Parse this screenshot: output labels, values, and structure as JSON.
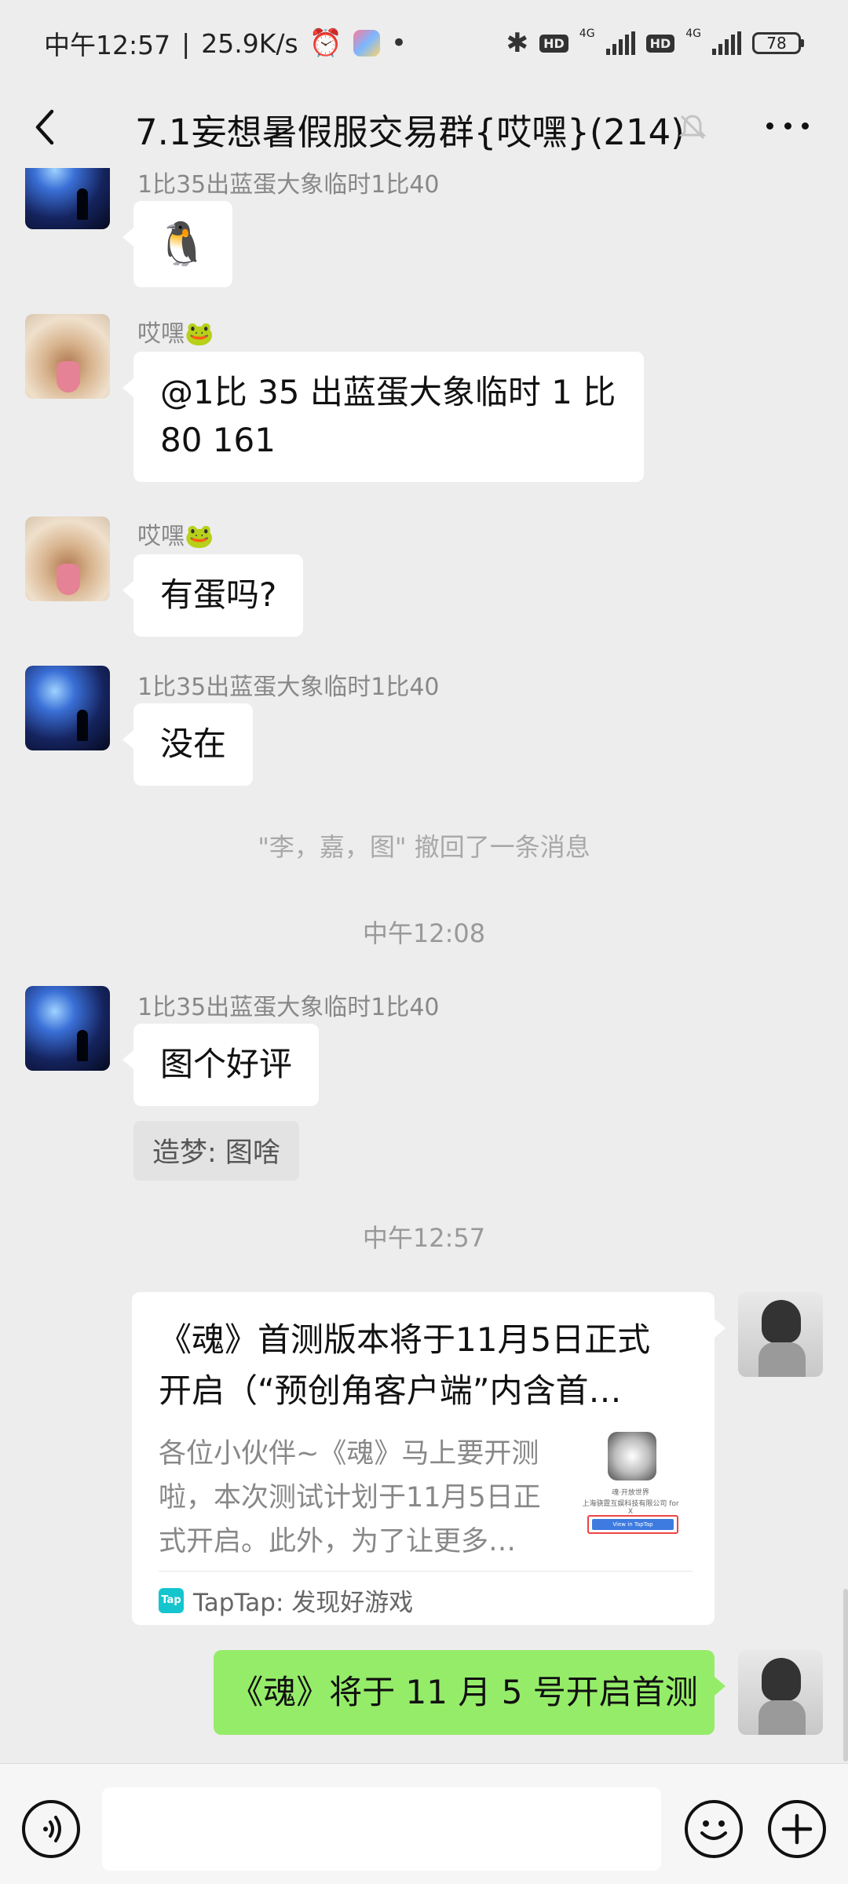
{
  "status_bar": {
    "time": "中午12:57",
    "speed": "25.9K/s",
    "dot": "•",
    "hd1": "HD",
    "net1": "4G",
    "hd2": "HD",
    "net2": "4G",
    "battery": "78"
  },
  "header": {
    "title": "7.1妄想暑假服交易群{哎嘿}(214)"
  },
  "messages": {
    "m0_sender": "1比35出蓝蛋大象临时1比40",
    "m0_text": "🐧",
    "m1_sender": "哎嘿🐸",
    "m1_text_line1": "@1比 35 出蓝蛋大象临时 1 比",
    "m1_text_line2": "80 161",
    "m2_sender": "哎嘿🐸",
    "m2_text": "有蛋吗?",
    "m3_sender": "1比35出蓝蛋大象临时1比40",
    "m3_text": "没在",
    "recall_notice": "\"李，嘉，图\" 撤回了一条消息",
    "time1": "中午12:08",
    "m4_sender": "1比35出蓝蛋大象临时1比40",
    "m4_text": "图个好评",
    "m4_quote": "造梦: 图啥",
    "time2": "中午12:57",
    "card": {
      "title": "《魂》首测版本将于11月5日正式开启（“预创角客户端”内含首…",
      "description": "各位小伙伴~《魂》马上要开测啦，本次测试计划于11月5日正式开启。此外，为了让更多…",
      "thumb_line1": "魂·开放世界",
      "thumb_line2": "上海骁霆互娱科技有限公司 for X",
      "thumb_button": "View in TapTap",
      "source_badge": "Tap",
      "source": "TapTap: 发现好游戏"
    },
    "m5_text": "《魂》将于 11 月 5 号开启首测"
  },
  "colors": {
    "background": "#ededed",
    "self_bubble": "#95ec69",
    "other_bubble": "#ffffff"
  }
}
